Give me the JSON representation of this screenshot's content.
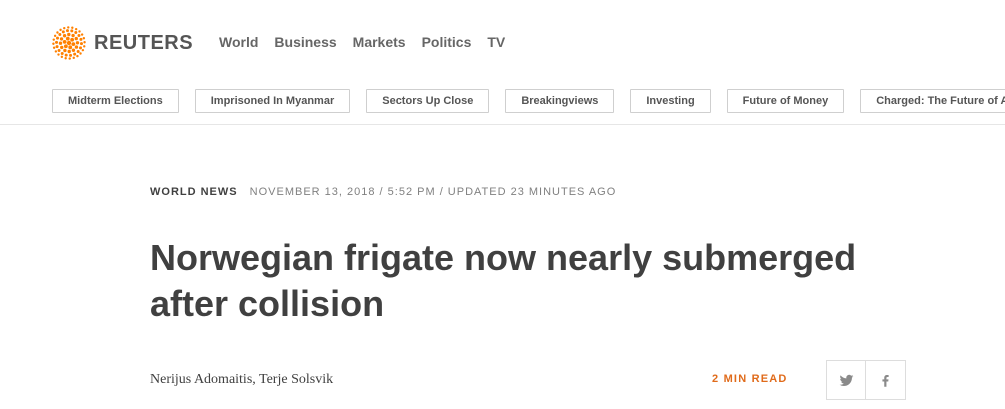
{
  "brand": {
    "name": "REUTERS",
    "accent_color": "#ff8000"
  },
  "primary_nav": [
    {
      "label": "World"
    },
    {
      "label": "Business"
    },
    {
      "label": "Markets"
    },
    {
      "label": "Politics"
    },
    {
      "label": "TV"
    }
  ],
  "topics": [
    {
      "label": "Midterm Elections"
    },
    {
      "label": "Imprisoned In Myanmar"
    },
    {
      "label": "Sectors Up Close"
    },
    {
      "label": "Breakingviews"
    },
    {
      "label": "Investing"
    },
    {
      "label": "Future of Money"
    },
    {
      "label": "Charged: The Future of Autos"
    }
  ],
  "article": {
    "section": "WORLD NEWS",
    "dateline": "NOVEMBER 13, 2018 / 5:52 PM / UPDATED 23 MINUTES AGO",
    "headline": "Norwegian frigate now nearly submerged after collision",
    "byline": "Nerijus Adomaitis, Terje Solsvik",
    "read_time": "2 MIN READ",
    "read_time_color": "#e06b1b"
  },
  "share": {
    "icons": [
      "twitter-icon",
      "facebook-icon"
    ]
  }
}
